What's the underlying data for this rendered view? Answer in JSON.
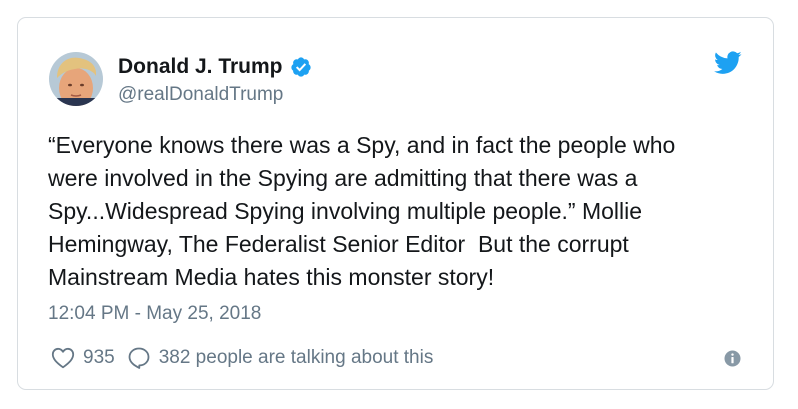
{
  "tweet": {
    "author": {
      "display_name": "Donald J. Trump",
      "handle": "@realDonaldTrump",
      "verified": true,
      "avatar_icon": "profile-photo"
    },
    "text": "“Everyone knows there was a Spy, and in fact the people who\nwere involved in the Spying are admitting that there was a\nSpy...Widespread Spying involving multiple people.” Mollie\nHemingway, The Federalist Senior Editor  But the corrupt\nMainstream Media hates this monster story!",
    "timestamp": "12:04 PM - May 25, 2018",
    "likes": "935",
    "replies_text": "382 people are talking about this"
  },
  "icons": {
    "brand": "twitter-bird-icon",
    "verified": "verified-badge-icon",
    "like": "heart-icon",
    "reply": "speech-bubble-icon",
    "info": "info-icon"
  },
  "colors": {
    "brand_blue": "#1da1f2",
    "text": "#14171a",
    "secondary_text": "#657786",
    "border": "#d8dde1",
    "info_icon": "#8899a6"
  }
}
